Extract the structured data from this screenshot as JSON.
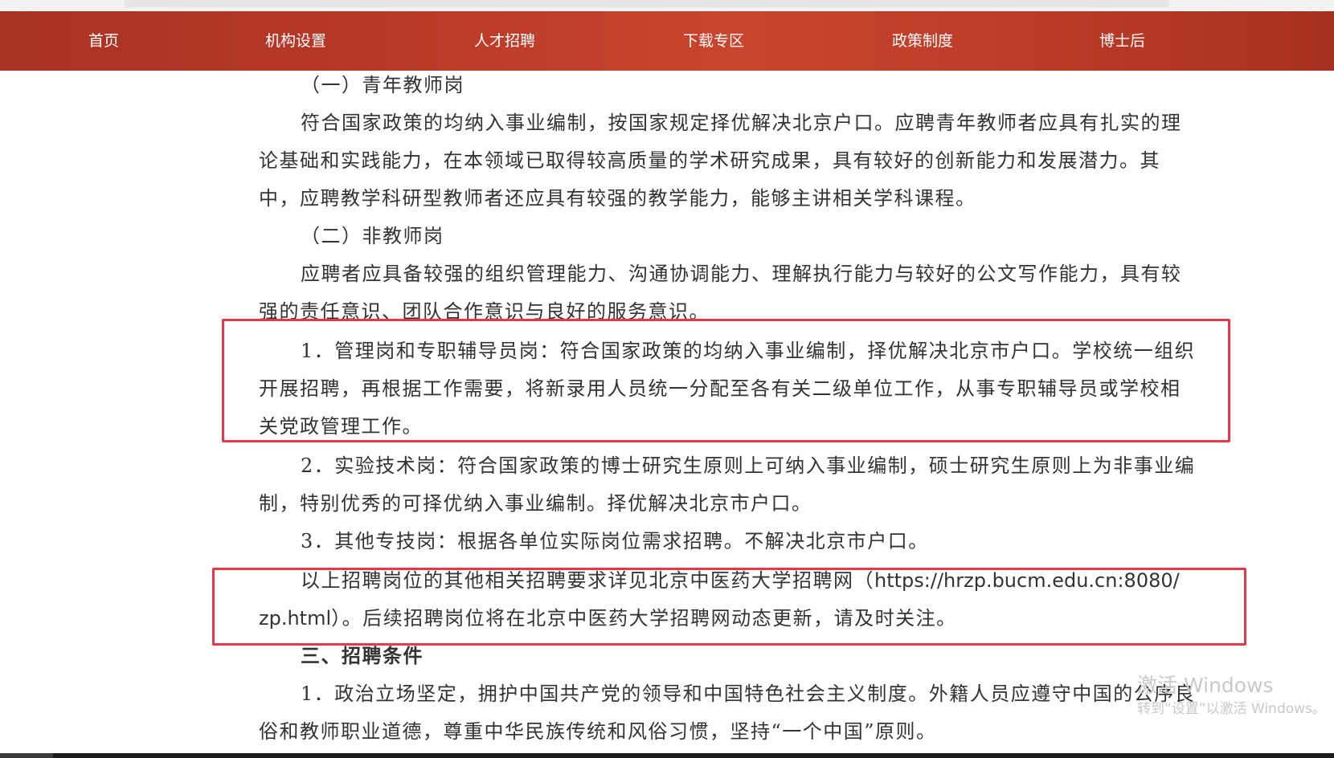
{
  "nav": {
    "items": [
      {
        "label": "首页"
      },
      {
        "label": "机构设置"
      },
      {
        "label": "人才招聘"
      },
      {
        "label": "下载专区"
      },
      {
        "label": "政策制度"
      },
      {
        "label": "博士后"
      }
    ]
  },
  "article": {
    "lines": [
      "（一）青年教师岗",
      "符合国家政策的均纳入事业编制，按国家规定择优解决北京户口。应聘青年教师者应具有扎实的理",
      "论基础和实践能力，在本领域已取得较高质量的学术研究成果，具有较好的创新能力和发展潜力。其",
      "中，应聘教学科研型教师者还应具有较强的教学能力，能够主讲相关学科课程。",
      "（二）非教师岗",
      "应聘者应具备较强的组织管理能力、沟通协调能力、理解执行能力与较好的公文写作能力，具有较",
      "强的责任意识、团队合作意识与良好的服务意识。",
      "1．管理岗和专职辅导员岗：符合国家政策的均纳入事业编制，择优解决北京市户口。学校统一组织",
      "开展招聘，再根据工作需要，将新录用人员统一分配至各有关二级单位工作，从事专职辅导员或学校相",
      "关党政管理工作。",
      "2．实验技术岗：符合国家政策的博士研究生原则上可纳入事业编制，硕士研究生原则上为非事业编",
      "制，特别优秀的可择优纳入事业编制。择优解决北京市户口。",
      "3．其他专技岗：根据各单位实际岗位需求招聘。不解决北京市户口。",
      "以上招聘岗位的其他相关招聘要求详见北京中医药大学招聘网（",
      "https://hrzp.bucm.edu.cn:8080/",
      "zp.html",
      "）。后续招聘岗位将在北京中医药大学招聘网动态更新，请及时关注。",
      "三、招聘条件",
      "1．政治立场坚定，拥护中国共产党的领导和中国特色社会主义制度。外籍人员应遵守中国的公序良",
      "俗和教师职业道德，尊重中华民族传统和风俗习惯，坚持“一个中国”原则。"
    ]
  },
  "watermark": {
    "title": "激活 Windows",
    "subtitle": "转到“设置”以激活 Windows。"
  },
  "colors": {
    "nav_bg": "#b83a28",
    "highlight_border": "#e5384a",
    "body_text": "#333333"
  }
}
